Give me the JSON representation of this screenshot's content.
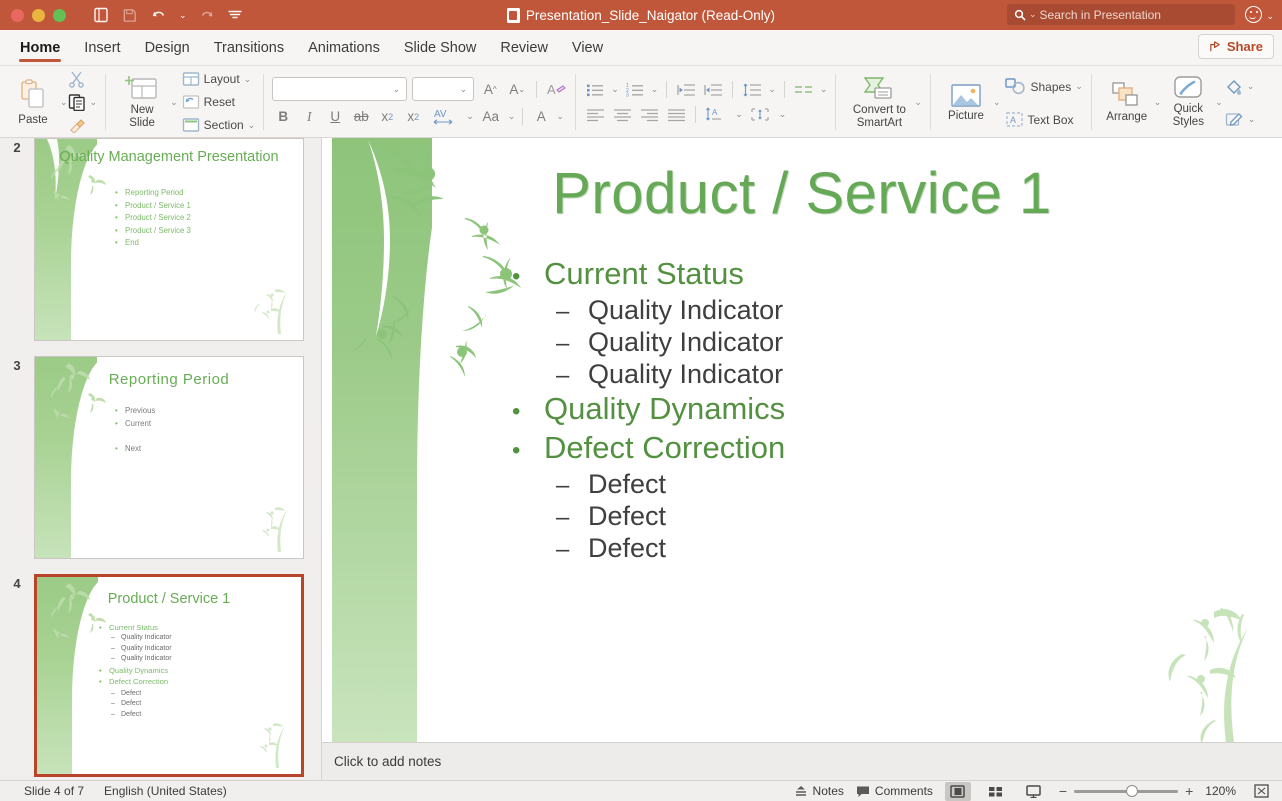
{
  "titlebar": {
    "document_title": "Presentation_Slide_Naigator (Read-Only)",
    "search_placeholder": "Search in Presentation",
    "accent_color": "#c1573a"
  },
  "tabs": [
    {
      "label": "Home",
      "active": true
    },
    {
      "label": "Insert",
      "active": false
    },
    {
      "label": "Design",
      "active": false
    },
    {
      "label": "Transitions",
      "active": false
    },
    {
      "label": "Animations",
      "active": false
    },
    {
      "label": "Slide Show",
      "active": false
    },
    {
      "label": "Review",
      "active": false
    },
    {
      "label": "View",
      "active": false
    }
  ],
  "share": {
    "label": "Share"
  },
  "ribbon": {
    "clipboard": {
      "paste_label": "Paste"
    },
    "slides": {
      "new_slide_label_line1": "New",
      "new_slide_label_line2": "Slide",
      "layout_label": "Layout",
      "reset_label": "Reset",
      "section_label": "Section"
    },
    "font": {
      "font_name_value": "",
      "font_size_value": "",
      "bold": "B",
      "italic": "I",
      "underline": "U",
      "strikethrough": "ab",
      "superscript": "x",
      "subscript": "x",
      "spacing": "AV",
      "change_case": "Aa",
      "font_color": "A"
    },
    "smartart": {
      "label_line1": "Convert to",
      "label_line2": "SmartArt"
    },
    "insert": {
      "picture_label": "Picture",
      "shapes_label": "Shapes",
      "textbox_label": "Text Box"
    },
    "drawing": {
      "arrange_label": "Arrange",
      "quick_styles_line1": "Quick",
      "quick_styles_line2": "Styles"
    }
  },
  "thumbnails": [
    {
      "number": "2",
      "selected": false,
      "title": "Quality Management Presentation",
      "bullets": [
        {
          "level": 1,
          "text": "Reporting  Period"
        },
        {
          "level": 1,
          "text": "Product / Service 1"
        },
        {
          "level": 1,
          "text": "Product / Service 2"
        },
        {
          "level": 1,
          "text": "Product / Service 3"
        },
        {
          "level": 1,
          "text": "End"
        }
      ]
    },
    {
      "number": "3",
      "selected": false,
      "title": "Reporting  Period",
      "bullets": [
        {
          "level": 1,
          "text": "Previous"
        },
        {
          "level": 1,
          "text": "Current"
        },
        {
          "level": 1,
          "text": ""
        },
        {
          "level": 1,
          "text": "Next"
        }
      ]
    },
    {
      "number": "4",
      "selected": true,
      "title": "Product / Service 1",
      "bullets": [
        {
          "level": 1,
          "text": "Current Status"
        },
        {
          "level": 2,
          "text": "Quality Indicator"
        },
        {
          "level": 2,
          "text": "Quality Indicator"
        },
        {
          "level": 2,
          "text": "Quality Indicator"
        },
        {
          "level": 1,
          "text": "Quality Dynamics"
        },
        {
          "level": 1,
          "text": "Defect Correction"
        },
        {
          "level": 2,
          "text": "Defect"
        },
        {
          "level": 2,
          "text": "Defect"
        },
        {
          "level": 2,
          "text": "Defect"
        }
      ]
    }
  ],
  "slide": {
    "title": "Product / Service 1",
    "bullets": [
      {
        "level": 1,
        "text": "Current Status"
      },
      {
        "level": 2,
        "text": "Quality Indicator"
      },
      {
        "level": 2,
        "text": "Quality Indicator"
      },
      {
        "level": 2,
        "text": "Quality Indicator"
      },
      {
        "level": 1,
        "text": "Quality Dynamics"
      },
      {
        "level": 1,
        "text": "Defect Correction"
      },
      {
        "level": 2,
        "text": "Defect"
      },
      {
        "level": 2,
        "text": "Defect"
      },
      {
        "level": 2,
        "text": "Defect"
      }
    ],
    "theme_green": "#65a855",
    "bullet_char": "•",
    "dash_char": "–"
  },
  "notes": {
    "placeholder": "Click to add notes"
  },
  "statusbar": {
    "slide_counter": "Slide 4 of 7",
    "language": "English (United States)",
    "notes_label": "Notes",
    "comments_label": "Comments",
    "zoom_level": "120%"
  }
}
